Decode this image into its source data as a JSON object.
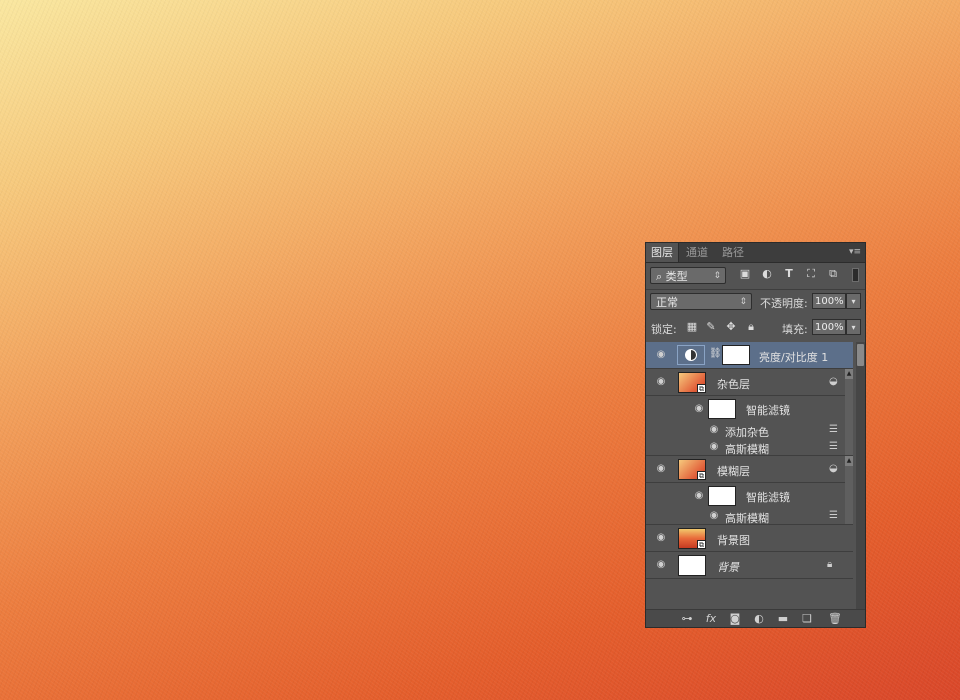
{
  "panel": {
    "tabs": [
      "图层",
      "通道",
      "路径"
    ],
    "active_tab": "图层",
    "menu_icon": "panel-menu-icon"
  },
  "filter": {
    "kind_label": "类型",
    "icons": [
      "image-filter-icon",
      "adjustment-filter-icon",
      "type-filter-icon",
      "shape-filter-icon",
      "smart-object-filter-icon"
    ]
  },
  "blend": {
    "mode": "正常",
    "opacity_label": "不透明度:",
    "opacity_value": "100%"
  },
  "lock": {
    "label": "锁定:",
    "fill_label": "填充:",
    "fill_value": "100%"
  },
  "layers": [
    {
      "name": "亮度/对比度 1",
      "type": "adjustment",
      "selected": true
    },
    {
      "name": "杂色层",
      "type": "smart-object"
    },
    {
      "name": "智能滤镜",
      "type": "smart-filters"
    },
    {
      "name": "添加杂色",
      "type": "filter"
    },
    {
      "name": "高斯模糊",
      "type": "filter"
    },
    {
      "name": "模糊层",
      "type": "smart-object"
    },
    {
      "name": "智能滤镜",
      "type": "smart-filters"
    },
    {
      "name": "高斯模糊",
      "type": "filter"
    },
    {
      "name": "背景图",
      "type": "smart-object"
    },
    {
      "name": "背景",
      "type": "background",
      "locked": true
    }
  ],
  "footer_icons": [
    "link-layers-icon",
    "fx-icon",
    "add-mask-icon",
    "new-adjustment-icon",
    "new-group-icon",
    "new-layer-icon",
    "delete-icon"
  ],
  "colors": {
    "panel_bg": "#535353",
    "selected_row": "#5c6f8a",
    "canvas_top": "#f9e7a0",
    "canvas_bottom": "#d9472a"
  }
}
